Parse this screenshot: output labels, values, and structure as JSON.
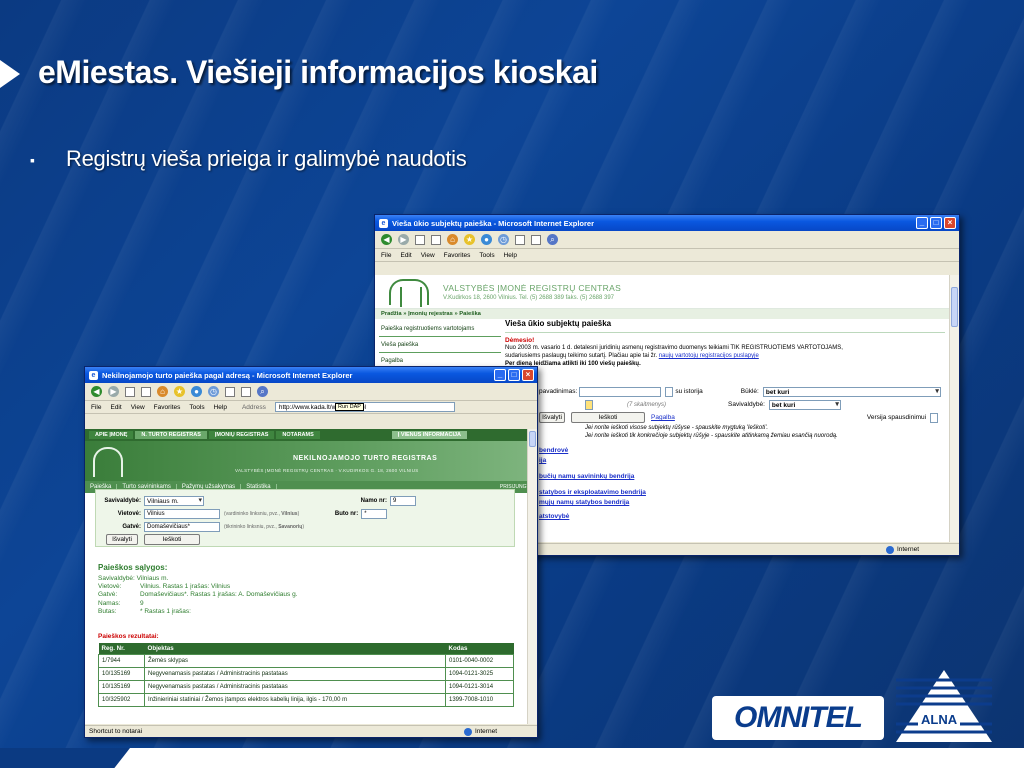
{
  "slide": {
    "title": "eMiestas. Viešieji informacijos kioskai",
    "bullet": "Registrų vieša prieiga ir galimybė naudotis",
    "logos": {
      "omnitel": "OMNITEL",
      "alna": "ALNA"
    }
  },
  "win1": {
    "title": "Vieša ūkio subjektų paieška - Microsoft Internet Explorer",
    "menu": [
      "File",
      "Edit",
      "View",
      "Favorites",
      "Tools",
      "Help"
    ],
    "org_name": "VALSTYBĖS ĮMONĖ REGISTRŲ CENTRAS",
    "org_address": "V.Kudirkos 18, 2600 Vilnius. Tel. (5) 2688 389 faks. (5) 2688 397",
    "breadcrumb": "Pradžia » Įmonių rejestras » Paieška",
    "side": [
      "Paieška registruotiems vartotojams",
      "Vieša paieška",
      "Pagalba"
    ],
    "heading": "Vieša ūkio subjektų paieška",
    "warn_title": "Dėmesio!",
    "warn_text_1": "Nuo 2003 m. vasario 1 d. detalesni juridinių asmenų registravimo duomenys teikiami TIK REGISTRUOTIEMS VARTOTOJAMS,",
    "warn_text_2": "sudariusiems paslaugų teikimo sutartį. Plačiau apie tai žr.",
    "warn_link": "naujų vartotojų registracijos puslapyje",
    "warn_text_3": "Per dieną leidžiama atlikti iki 100 viešų paieškų.",
    "form": {
      "name_label": "pavadinimas:",
      "history_label": "su istorija",
      "keywords_hint": "(7 skaitmenys)",
      "status_label": "Būklė:",
      "status_value": "bet kuri",
      "municipality_label": "Savivaldybė:",
      "municipality_value": "bet kuri",
      "print_label": "Versija spausdinimui",
      "clear_btn": "Išvalyti",
      "search_btn": "Ieškoti",
      "help_link": "Pagalba"
    },
    "hint_1": "Jei norite ieškoti visose subjektų rūšyse - spauskite mygtuką 'Ieškoti'.",
    "hint_2": "Jei norite ieškoti tik konkrečioje subjektų rūšyje - spauskite atitinkamą žemiau esančią nuorodą.",
    "results": [
      "bendrovė",
      "ija",
      "bučių namų savininkų bendrija",
      "statybos ir eksploatavimo bendrija",
      "mųjų namų statybos bendrija",
      "atstovybė"
    ],
    "status_zone": "Internet"
  },
  "win2": {
    "title": "Nekilnojamojo turto paieška pagal adresą - Microsoft Internet Explorer",
    "menu": [
      "File",
      "Edit",
      "View",
      "Favorites",
      "Tools",
      "Help"
    ],
    "address_label": "Address",
    "address_value": "http://www.kada.lt/webindex.pl",
    "tooltip": "Run DAP",
    "tabs": [
      "APIE ĮMONĘ",
      "N. TURTO REGISTRAS",
      "ĮMONIŲ REGISTRAS",
      "NOTARAMS",
      "Į VIENUS INFORMACIJA"
    ],
    "banner_title": "NEKILNOJAMOJO TURTO REGISTRAS",
    "banner_sub": "VALSTYBĖS ĮMONĖ REGISTRŲ CENTRAS · V.KUDIRKOS G. 18, 2600 VILNIUS",
    "nav": [
      "Paieška",
      "Turto savininkams",
      "Pažymų užsakymas",
      "Statistika"
    ],
    "nav_right": "PRISIJUNGTI",
    "form": {
      "municipality_label": "Savivaldybė:",
      "municipality_value": "Vilniaus m.",
      "place_label": "Vietovė:",
      "place_value": "Vilnius",
      "place_hint": "(vardininko linksniu, pvz.,",
      "place_hint_bold": "Vilnius",
      "street_label": "Gatvė:",
      "street_value": "Domaševičiaus*",
      "street_hint": "(tikrininko linksniu, pvz.,",
      "street_hint_bold": "Savanorių",
      "house_label": "Namo nr:",
      "house_value": "9",
      "flat_label": "Buto nr:",
      "flat_value": "*",
      "clear_btn": "Išvalyti",
      "search_btn": "Ieškoti"
    },
    "cond_title": "Paieškos sąlygos:",
    "conditions": [
      {
        "k": "Savivaldybė: Vilniaus m.",
        "v": ""
      },
      {
        "k": "Vietovė:",
        "v": "Vilnius.   Rastas 1 įrašas: Vilnius"
      },
      {
        "k": "Gatvė:",
        "v": "Domaševičiaus*.   Rastas 1 įrašas: A. Domaševičiaus g."
      },
      {
        "k": "Namas:",
        "v": "9"
      },
      {
        "k": "Butas:",
        "v": "*   Rastas 1 įrašas:"
      }
    ],
    "results_title": "Paieškos rezultatai:",
    "table": {
      "headers": [
        "Reg. Nr.",
        "Objektas",
        "Kodas"
      ],
      "rows": [
        [
          "1/7944",
          "Žemės sklypas",
          "0101-0040-0002"
        ],
        [
          "10/135169",
          "Negyvenamasis pastatas / Administracinis pastataas",
          "1094-0121-3025"
        ],
        [
          "10/135169",
          "Negyvenamasis pastatas / Administracinis pastataas",
          "1094-0121-3014"
        ],
        [
          "10/325902",
          "Inžinieriniai statiniai / Žemos įtampos elektros kabelių linija, ilgis - 170,00 m",
          "1399-7008-1010"
        ]
      ]
    },
    "status_left": "Shortcut to notarai",
    "status_zone": "Internet"
  }
}
